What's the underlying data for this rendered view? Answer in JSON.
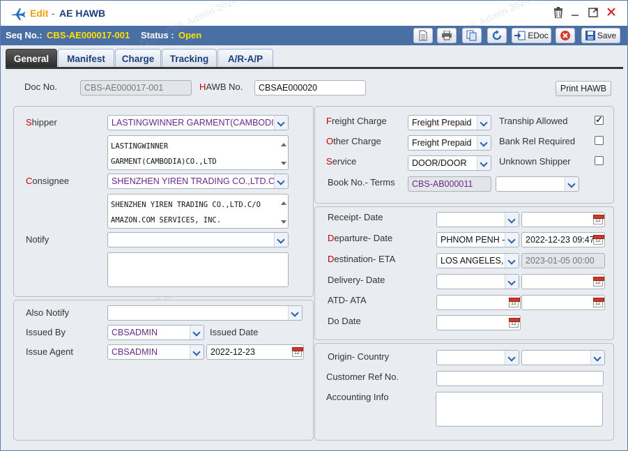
{
  "window": {
    "edit_label": "Edit",
    "dash": "-",
    "title": "AE HAWB"
  },
  "infobar": {
    "seq_label": "Seq No.:",
    "seq_value": "CBS-AE000017-001",
    "status_label": "Status :",
    "status_value": "Open",
    "edoc_label": "EDoc",
    "save_label": "Save"
  },
  "tabs": [
    "General",
    "Manifest",
    "Charge",
    "Tracking",
    "A/R-A/P"
  ],
  "header": {
    "doc_no_label": "Doc No.",
    "doc_no_value": "CBS-AE000017-001",
    "hawb_label_first": "H",
    "hawb_label_rest": "AWB No.",
    "hawb_value": "CBSAE000020",
    "print_hawb_label": "Print HAWB"
  },
  "parties": {
    "shipper_label_first": "S",
    "shipper_label_rest": "hipper",
    "shipper_value": "LASTINGWINNER GARMENT(CAMBODIA",
    "shipper_address": [
      "LASTINGWINNER",
      "GARMENT(CAMBODIA)CO.,LTD"
    ],
    "consignee_label_first": "C",
    "consignee_label_rest": "onsignee",
    "consignee_value": "SHENZHEN YIREN TRADING CO.,LTD.C/O",
    "consignee_address": [
      "SHENZHEN YIREN TRADING CO.,LTD.C/O",
      "AMAZON.COM SERVICES, INC."
    ],
    "notify_label": "Notify",
    "notify_value": "",
    "notify_address": ""
  },
  "issue": {
    "also_notify_label": "Also Notify",
    "also_notify_value": "",
    "issued_by_label": "Issued By",
    "issued_by_value": "CBSADMIN",
    "issued_date_label": "Issued Date",
    "issue_agent_label": "Issue Agent",
    "issue_agent_value": "CBSADMIN",
    "issue_date_value": "2022-12-23"
  },
  "charges": {
    "freight_label_first": "F",
    "freight_label_rest": "reight Charge",
    "freight_value": "Freight Prepaid",
    "other_label_first": "O",
    "other_label_rest": "ther Charge",
    "other_value": "Freight Prepaid",
    "service_label_first": "S",
    "service_label_rest": "ervice",
    "service_value": "DOOR/DOOR",
    "book_terms_label": "Book No.- Terms",
    "book_no_value": "CBS-AB000011",
    "terms_value": "",
    "tranship_label": "Tranship Allowed",
    "tranship_checked": true,
    "bank_rel_label": "Bank Rel Required",
    "bank_rel_checked": false,
    "unknown_shipper_label": "Unknown Shipper",
    "unknown_shipper_checked": false
  },
  "dates": {
    "receipt_label": "Receipt- Date",
    "receipt_place": "",
    "receipt_date": "",
    "departure_label_first": "D",
    "departure_label_rest": "eparture- Date",
    "departure_place": "PHNOM PENH -",
    "departure_date": "2022-12-23 09:47",
    "destination_label_first": "D",
    "destination_label_rest": "estination- ETA",
    "destination_place": "LOS ANGELES, C",
    "destination_eta": "2023-01-05 00:00",
    "delivery_label": "Delivery- Date",
    "delivery_place": "",
    "delivery_date": "",
    "atd_ata_label": "ATD- ATA",
    "atd_value": "",
    "ata_value": "",
    "do_date_label": "Do Date",
    "do_date_value": ""
  },
  "origin": {
    "origin_country_label": "Origin- Country",
    "origin_value": "",
    "country_value": "",
    "customer_ref_label": "Customer Ref No.",
    "customer_ref_value": "",
    "accounting_info_label": "Accounting Info",
    "accounting_info_value": ""
  },
  "watermark": "TLKA.CBS.Admin 2024-08-30",
  "colors": {
    "infobar_bg": "#4a6fa5",
    "highlight_yellow": "#ffe000",
    "title_orange": "#f0a000",
    "required_red": "#c00000",
    "purple_value": "#6a2a8a"
  }
}
